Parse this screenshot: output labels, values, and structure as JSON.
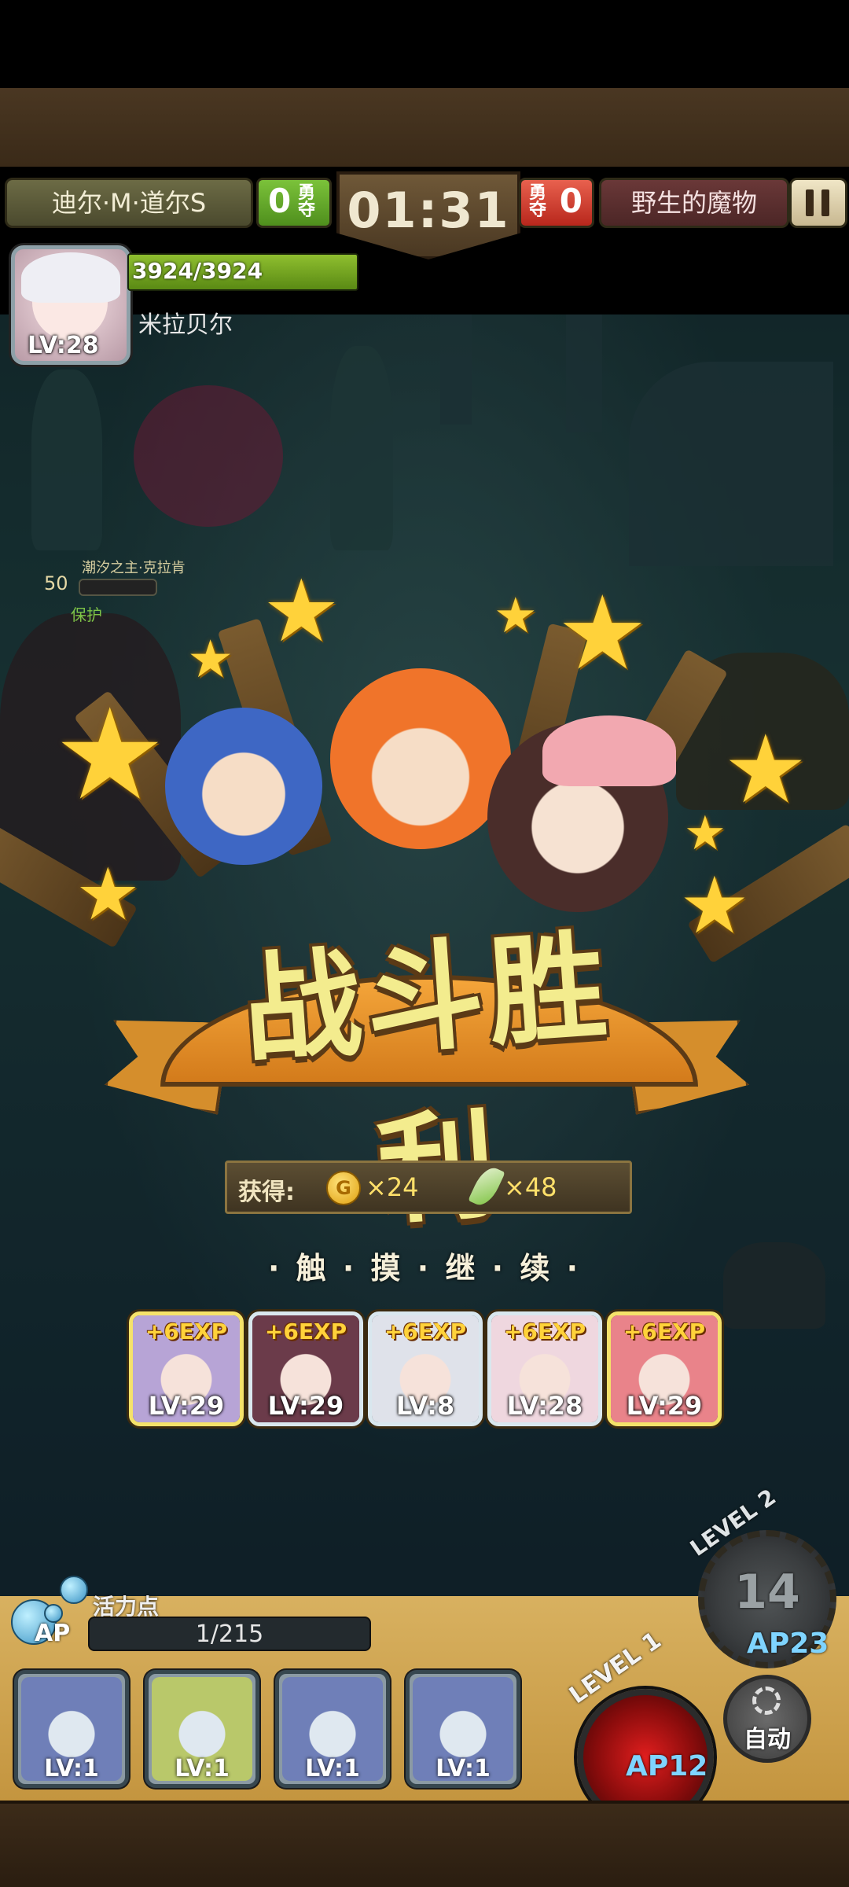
{
  "hud": {
    "player_name": "迪尔·M·道尔S",
    "player_score": "0",
    "enemy_name": "野生的魔物",
    "enemy_score": "0",
    "score_label": "勇夺",
    "timer": "01:31"
  },
  "hero": {
    "hp_text": "3924/3924",
    "hp_fraction": 1.0,
    "name": "米拉贝尔",
    "level": "LV:28"
  },
  "boss": {
    "title": "潮汐之主·克拉肯",
    "level": "50",
    "status": "保护"
  },
  "victory": {
    "title": "战斗胜利",
    "reward_label": "获得:",
    "coin_icon_glyph": "G",
    "coin_amount": "×24",
    "feather_amount": "×48",
    "continue_text": "· 触 · 摸 · 继 · 续 ·"
  },
  "party": [
    {
      "exp": "+6EXP",
      "level": "LV:29",
      "frame": "gold",
      "color": "#b7a4d6"
    },
    {
      "exp": "+6EXP",
      "level": "LV:29",
      "frame": "silver",
      "color": "#6b3b4a"
    },
    {
      "exp": "+6EXP",
      "level": "LV:8",
      "frame": "silver",
      "color": "#dfe2ea"
    },
    {
      "exp": "+6EXP",
      "level": "LV:28",
      "frame": "silver",
      "color": "#efd7df"
    },
    {
      "exp": "+6EXP",
      "level": "LV:29",
      "frame": "gold",
      "color": "#e9838a"
    }
  ],
  "bottom": {
    "vitality_label": "活力点",
    "ap_label": "AP",
    "ap_text": "1/215",
    "units": [
      {
        "level": "LV:1",
        "color": "#6f7fb8"
      },
      {
        "level": "LV:1",
        "color": "#b9c86a"
      },
      {
        "level": "LV:1",
        "color": "#6f7fb8"
      },
      {
        "level": "LV:1",
        "color": "#6f7fb8"
      }
    ],
    "level2_label": "LEVEL 2",
    "gear_number": "14",
    "ap23": "AP23",
    "level1_label": "LEVEL 1",
    "ap12": "AP12",
    "auto_label": "自动"
  }
}
